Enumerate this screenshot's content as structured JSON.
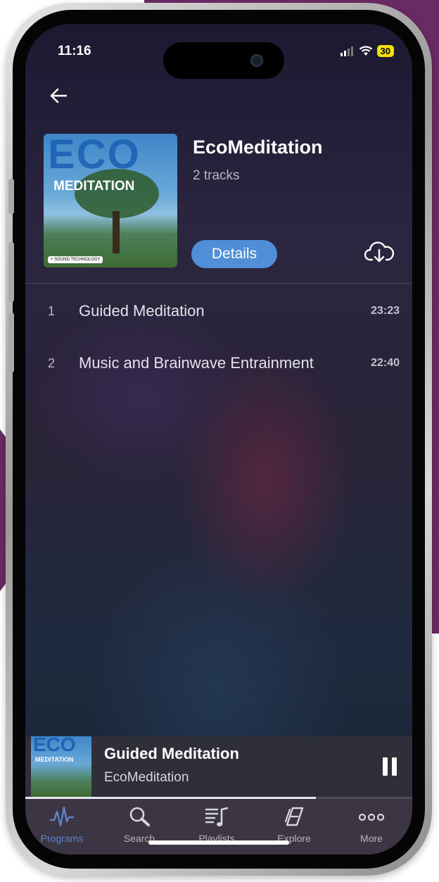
{
  "status_bar": {
    "time": "11:16",
    "battery": "30"
  },
  "album": {
    "art_text_top": "ECO",
    "art_text_bottom": "MEDITATION",
    "art_badge": "+ SOUND TECHNOLOGY",
    "title": "EcoMeditation",
    "tracks_count": "2 tracks",
    "details_label": "Details"
  },
  "tracks": [
    {
      "number": "1",
      "title": "Guided Meditation",
      "duration": "23:23"
    },
    {
      "number": "2",
      "title": "Music and Brainwave Entrainment",
      "duration": "22:40"
    }
  ],
  "now_playing": {
    "art_text_top": "ECO",
    "art_text_bottom": "MEDITATION",
    "title": "Guided Meditation",
    "album": "EcoMeditation",
    "progress": 0.75
  },
  "tabs": [
    {
      "label": "Programs",
      "icon": "programs-wave-icon",
      "active": true
    },
    {
      "label": "Search",
      "icon": "search-icon",
      "active": false
    },
    {
      "label": "Playlists",
      "icon": "playlists-icon",
      "active": false
    },
    {
      "label": "Explore",
      "icon": "explore-book-icon",
      "active": false
    },
    {
      "label": "More",
      "icon": "more-dots-icon",
      "active": false
    }
  ],
  "colors": {
    "accent": "#4f8fd8",
    "active_tab": "#5e84c6",
    "tab_bar_bg": "#3b3544",
    "mini_player_bg": "#2f2f3a",
    "battery": "#f5e000",
    "frame_purple": "#6a2a63"
  }
}
